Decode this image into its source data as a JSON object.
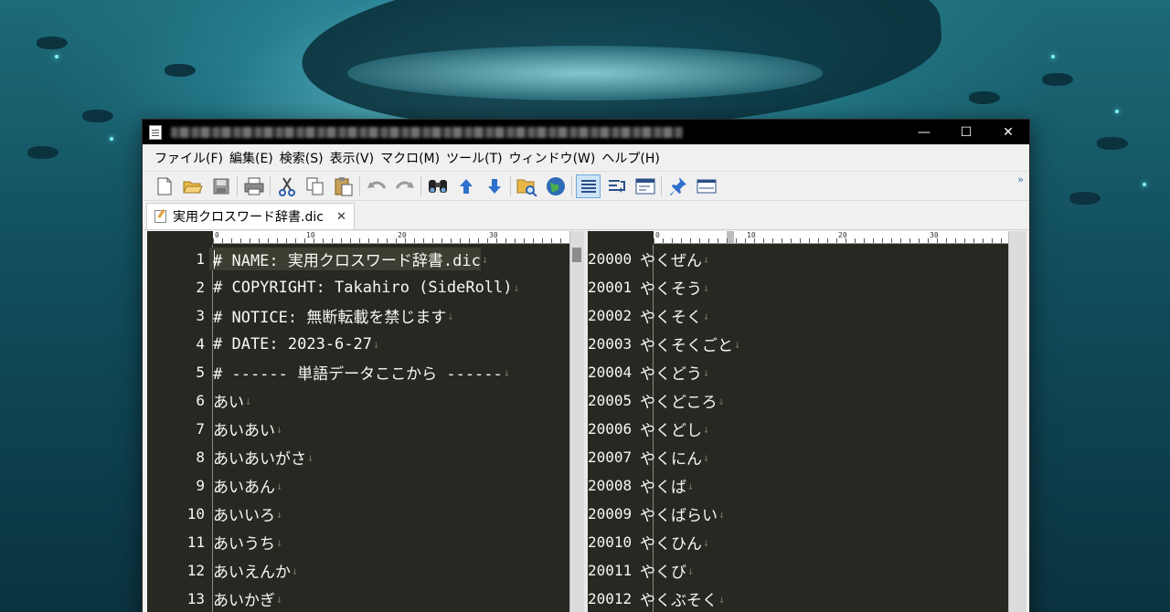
{
  "window": {
    "title": "",
    "controls": {
      "minimize": "—",
      "maximize": "☐",
      "close": "✕"
    }
  },
  "menu": [
    "ファイル(F)",
    "編集(E)",
    "検索(S)",
    "表示(V)",
    "マクロ(M)",
    "ツール(T)",
    "ウィンドウ(W)",
    "ヘルプ(H)"
  ],
  "toolbar": {
    "buttons": [
      "new-file-icon",
      "open-file-icon",
      "save-icon",
      "|",
      "print-icon",
      "|",
      "cut-icon",
      "copy-icon",
      "paste-icon",
      "|",
      "undo-icon",
      "redo-icon",
      "|",
      "find-icon",
      "find-up-icon",
      "find-down-icon",
      "|",
      "grep-icon",
      "web-icon",
      "|",
      "wrap-off-icon",
      "wrap-on-icon",
      "outline-icon",
      "|",
      "pin-icon",
      "panel-icon"
    ],
    "more": "»"
  },
  "tab": {
    "label": "実用クロスワード辞書.dic",
    "close": "✕"
  },
  "ruler": {
    "ticks": [
      "0",
      "10",
      "20",
      "30"
    ]
  },
  "left_pane": {
    "lines": [
      {
        "num": "1",
        "text": "# NAME:     実用クロスワード辞書.dic"
      },
      {
        "num": "2",
        "text": "# COPYRIGHT: Takahiro (SideRoll)"
      },
      {
        "num": "3",
        "text": "# NOTICE:    無断転載を禁じます"
      },
      {
        "num": "4",
        "text": "# DATE:      2023-6-27"
      },
      {
        "num": "5",
        "text": "# ------ 単語データここから ------"
      },
      {
        "num": "6",
        "text": "あい"
      },
      {
        "num": "7",
        "text": "あいあい"
      },
      {
        "num": "8",
        "text": "あいあいがさ"
      },
      {
        "num": "9",
        "text": "あいあん"
      },
      {
        "num": "10",
        "text": "あいいろ"
      },
      {
        "num": "11",
        "text": "あいうち"
      },
      {
        "num": "12",
        "text": "あいえんか"
      },
      {
        "num": "13",
        "text": "あいかぎ"
      }
    ]
  },
  "right_pane": {
    "lines": [
      {
        "num": "20000",
        "text": "やくぜん"
      },
      {
        "num": "20001",
        "text": "やくそう"
      },
      {
        "num": "20002",
        "text": "やくそく"
      },
      {
        "num": "20003",
        "text": "やくそくごと"
      },
      {
        "num": "20004",
        "text": "やくどう"
      },
      {
        "num": "20005",
        "text": "やくどころ"
      },
      {
        "num": "20006",
        "text": "やくどし"
      },
      {
        "num": "20007",
        "text": "やくにん"
      },
      {
        "num": "20008",
        "text": "やくば"
      },
      {
        "num": "20009",
        "text": "やくばらい"
      },
      {
        "num": "20010",
        "text": "やくひん"
      },
      {
        "num": "20011",
        "text": "やくび"
      },
      {
        "num": "20012",
        "text": "やくぶそく"
      }
    ]
  },
  "eol_mark": "↓",
  "colors": {
    "editor_bg": "#272822",
    "editor_fg": "#f8f8f2",
    "eol": "#75715e",
    "current_line": "#3e3d32"
  }
}
